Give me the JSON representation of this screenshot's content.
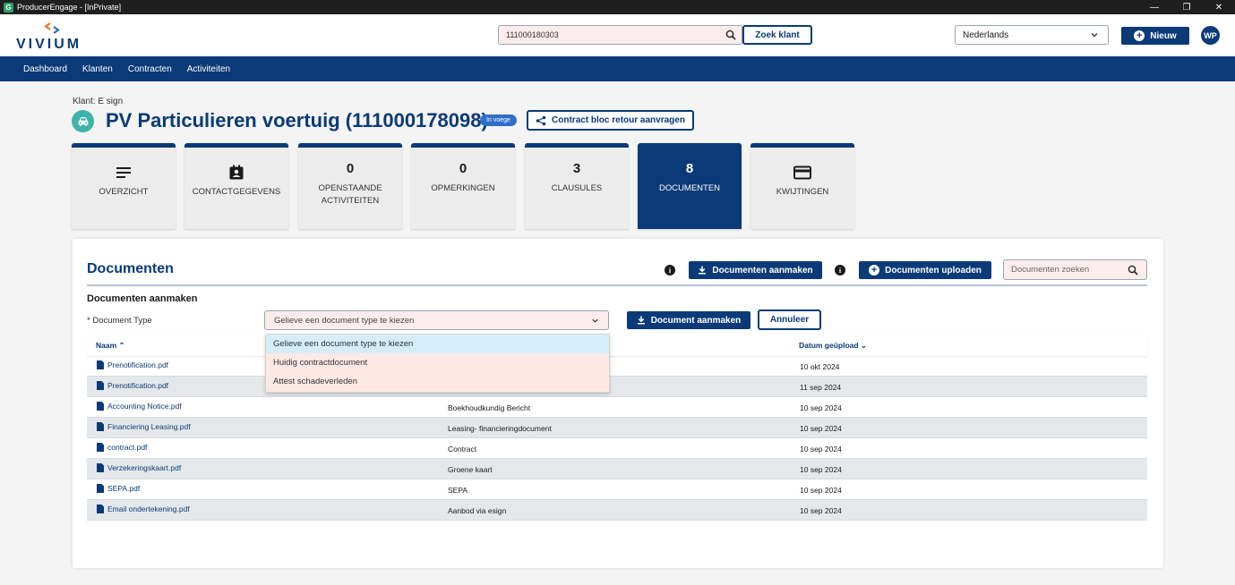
{
  "window": {
    "title": "ProducerEngage - [InPrivate]",
    "app_icon": "G",
    "minimize": "—",
    "restore": "❐",
    "close": "✕"
  },
  "header": {
    "logo_text": "VIVIUM",
    "search_value": "111000180303",
    "search_button": "Zoek klant",
    "language": "Nederlands",
    "new_button": "Nieuw",
    "avatar_initials": "WP"
  },
  "nav": {
    "items": [
      "Dashboard",
      "Klanten",
      "Contracten",
      "Activiteiten"
    ]
  },
  "page": {
    "klant_label": "Klant: E sign",
    "title": "PV Particulieren voertuig (111000178098)",
    "status": "In voege",
    "contract_button": "Contract bloc retour aanvragen"
  },
  "tiles": [
    {
      "label": "OVERZICHT",
      "count": "",
      "icon": "lines-icon",
      "active": false
    },
    {
      "label": "CONTACTGEGEVENS",
      "count": "",
      "icon": "contact-card-icon",
      "active": false
    },
    {
      "label": "OPENSTAANDE ACTIVITEITEN",
      "count": "0",
      "icon": "",
      "active": false
    },
    {
      "label": "OPMERKINGEN",
      "count": "0",
      "icon": "",
      "active": false
    },
    {
      "label": "CLAUSULES",
      "count": "3",
      "icon": "",
      "active": false
    },
    {
      "label": "DOCUMENTEN",
      "count": "8",
      "icon": "",
      "active": true
    },
    {
      "label": "KWIJTINGEN",
      "count": "",
      "icon": "credit-card-icon",
      "active": false
    }
  ],
  "documents": {
    "title": "Documenten",
    "create_button": "Documenten aanmaken",
    "upload_button": "Documenten uploaden",
    "search_placeholder": "Documenten zoeken",
    "info_symbol": "i",
    "section_title": "Documenten aanmaken",
    "doc_type_label": "* Document Type",
    "doc_type_placeholder": "Gelieve een document type te kiezen",
    "create_single_button": "Document aanmaken",
    "cancel_button": "Annuleer",
    "dropdown_options": [
      "Gelieve een document type te kiezen",
      "Huidig contractdocument",
      "Attest schadeverleden"
    ],
    "columns": {
      "name": "Naam",
      "date": "Datum geüpload"
    },
    "rows": [
      {
        "name": "Prenotification.pdf",
        "type": "",
        "date": "10 okt 2024"
      },
      {
        "name": "Prenotification.pdf",
        "type": "",
        "date": "11 sep 2024"
      },
      {
        "name": "Accounting Notice.pdf",
        "type": "Boekhoudkundig Bericht",
        "date": "10 sep 2024"
      },
      {
        "name": "Financiering Leasing.pdf",
        "type": "Leasing- financieringdocument",
        "date": "10 sep 2024"
      },
      {
        "name": "contract.pdf",
        "type": "Contract",
        "date": "10 sep 2024"
      },
      {
        "name": "Verzekeringskaart.pdf",
        "type": "Groene kaart",
        "date": "10 sep 2024"
      },
      {
        "name": "SEPA.pdf",
        "type": "SEPA",
        "date": "10 sep 2024"
      },
      {
        "name": "Email ondertekening.pdf",
        "type": "Aanbod via esign",
        "date": "10 sep 2024"
      }
    ]
  },
  "colors": {
    "primary": "#0a3a78",
    "accent": "#3fb3a8",
    "field_bg": "#fdecec"
  }
}
